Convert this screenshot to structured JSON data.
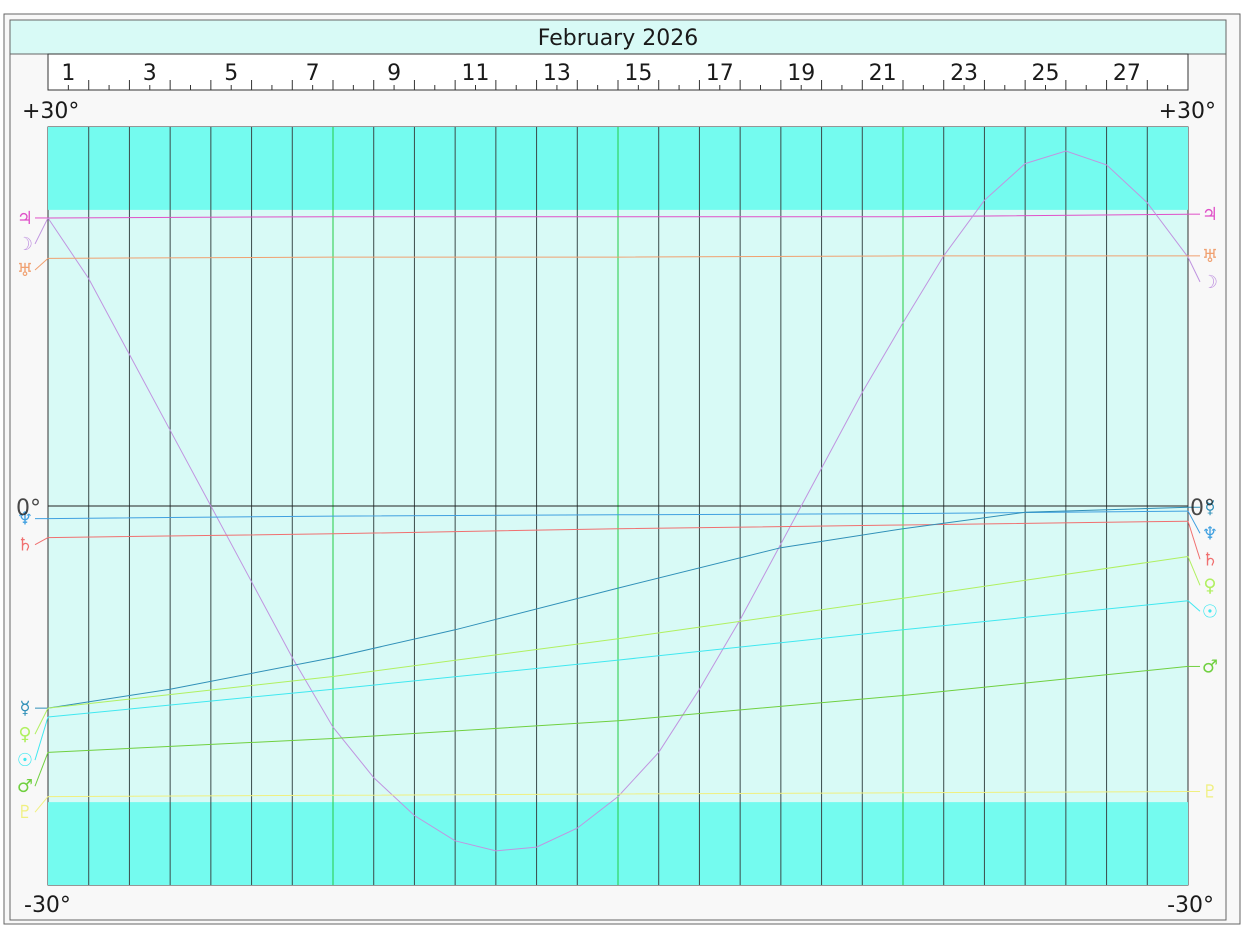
{
  "chart_data": {
    "type": "line",
    "title": "February 2026",
    "x": {
      "unit": "day",
      "range": [
        1,
        29
      ],
      "tick_labels": [
        "1",
        "3",
        "5",
        "7",
        "9",
        "11",
        "13",
        "15",
        "17",
        "19",
        "21",
        "23",
        "25",
        "27"
      ],
      "major_gridline_days": [
        8,
        15,
        22
      ]
    },
    "y": {
      "unit": "degrees declination",
      "range": [
        -30,
        30
      ],
      "labels": {
        "top_left": "+30°",
        "top_right": "+30°",
        "bottom_left": "-30°",
        "bottom_right": "-30°",
        "zero_left": "0°",
        "zero_right": "0°"
      },
      "band_limits": [
        -23.44,
        23.44
      ]
    },
    "grid": true,
    "legend": "planet glyphs at both ends of each line",
    "series": [
      {
        "glyph": "♃",
        "color": "#e050c8",
        "points": [
          [
            1,
            22.8
          ],
          [
            8,
            22.9
          ],
          [
            15,
            22.9
          ],
          [
            22,
            22.9
          ],
          [
            29,
            23.1
          ]
        ]
      },
      {
        "glyph": "☽",
        "color": "#c094e0",
        "points": [
          [
            1,
            22.8
          ],
          [
            2,
            18.0
          ],
          [
            3,
            12.0
          ],
          [
            4,
            6.0
          ],
          [
            5,
            0.0
          ],
          [
            6,
            -6.0
          ],
          [
            7,
            -12.0
          ],
          [
            8,
            -17.5
          ],
          [
            9,
            -21.5
          ],
          [
            10,
            -24.5
          ],
          [
            11,
            -26.5
          ],
          [
            12,
            -27.3
          ],
          [
            13,
            -27.0
          ],
          [
            14,
            -25.5
          ],
          [
            15,
            -23.0
          ],
          [
            16,
            -19.5
          ],
          [
            17,
            -14.5
          ],
          [
            18,
            -9.0
          ],
          [
            19,
            -3.0
          ],
          [
            20,
            3.0
          ],
          [
            21,
            9.0
          ],
          [
            22,
            14.5
          ],
          [
            23,
            19.8
          ],
          [
            24,
            24.2
          ],
          [
            25,
            27.1
          ],
          [
            26,
            28.1
          ],
          [
            27,
            27.0
          ],
          [
            28,
            24.0
          ],
          [
            29,
            19.7
          ]
        ]
      },
      {
        "glyph": "♅",
        "color": "#f0a070",
        "points": [
          [
            1,
            19.6
          ],
          [
            8,
            19.7
          ],
          [
            15,
            19.7
          ],
          [
            22,
            19.8
          ],
          [
            29,
            19.8
          ]
        ]
      },
      {
        "glyph": "♆",
        "color": "#40a0e0",
        "points": [
          [
            1,
            -1.0
          ],
          [
            8,
            -0.8
          ],
          [
            15,
            -0.7
          ],
          [
            22,
            -0.6
          ],
          [
            29,
            -0.4
          ]
        ]
      },
      {
        "glyph": "♄",
        "color": "#f07070",
        "points": [
          [
            1,
            -2.5
          ],
          [
            8,
            -2.2
          ],
          [
            15,
            -1.8
          ],
          [
            22,
            -1.5
          ],
          [
            29,
            -1.2
          ]
        ]
      },
      {
        "glyph": "☿",
        "color": "#3090b8",
        "points": [
          [
            1,
            -16.0
          ],
          [
            4,
            -14.5
          ],
          [
            8,
            -12.0
          ],
          [
            11,
            -9.8
          ],
          [
            15,
            -6.5
          ],
          [
            19,
            -3.3
          ],
          [
            22,
            -1.8
          ],
          [
            25,
            -0.5
          ],
          [
            29,
            -0.1
          ]
        ]
      },
      {
        "glyph": "♀",
        "color": "#b0f060",
        "points": [
          [
            1,
            -16.0
          ],
          [
            8,
            -13.5
          ],
          [
            15,
            -10.5
          ],
          [
            22,
            -7.3
          ],
          [
            29,
            -4.0
          ]
        ]
      },
      {
        "glyph": "☉",
        "color": "#40e8f0",
        "points": [
          [
            1,
            -16.7
          ],
          [
            8,
            -14.5
          ],
          [
            15,
            -12.2
          ],
          [
            22,
            -9.8
          ],
          [
            29,
            -7.5
          ]
        ]
      },
      {
        "glyph": "♂",
        "color": "#70d040",
        "points": [
          [
            1,
            -19.5
          ],
          [
            8,
            -18.4
          ],
          [
            15,
            -17.0
          ],
          [
            22,
            -15.0
          ],
          [
            29,
            -12.7
          ]
        ]
      },
      {
        "glyph": "♇",
        "color": "#f0f080",
        "points": [
          [
            1,
            -23.0
          ],
          [
            8,
            -22.9
          ],
          [
            15,
            -22.8
          ],
          [
            22,
            -22.7
          ],
          [
            29,
            -22.6
          ]
        ]
      }
    ],
    "left_glyph_order": [
      "♃",
      "☽",
      "♅",
      "♆",
      "♄",
      "☿",
      "♀",
      "☉",
      "♂",
      "♇"
    ],
    "right_glyph_order": [
      "♃",
      "♅",
      "☽",
      "☿",
      "♆",
      "♄",
      "♀",
      "☉",
      "♂",
      "♇"
    ]
  }
}
